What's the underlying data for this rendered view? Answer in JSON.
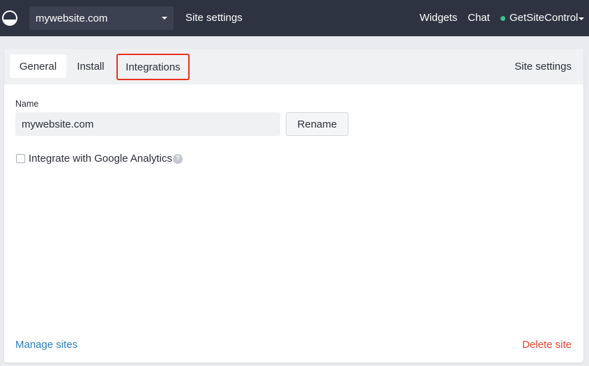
{
  "topbar": {
    "site_selector": "mywebsite.com",
    "site_settings_link": "Site settings",
    "widgets_link": "Widgets",
    "chat_link": "Chat",
    "account": "GetSiteControl",
    "status_color": "#3fbf8f"
  },
  "tabs": [
    {
      "label": "General",
      "active": true
    },
    {
      "label": "Install",
      "active": false
    },
    {
      "label": "Integrations",
      "active": false,
      "highlighted": true
    }
  ],
  "header_right": "Site settings",
  "form": {
    "name_label": "Name",
    "name_value": "mywebsite.com",
    "rename_label": "Rename",
    "ga_label": "Integrate with Google Analytics",
    "ga_checked": false,
    "help_glyph": "?"
  },
  "footer": {
    "manage_label": "Manage sites",
    "delete_label": "Delete site"
  },
  "colors": {
    "topbar": "#2d3340",
    "accent_link": "#2b7fc3",
    "danger": "#e5452e",
    "highlight_box": "#e8321f"
  }
}
